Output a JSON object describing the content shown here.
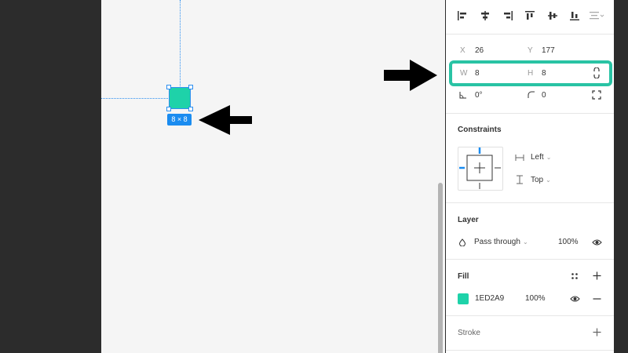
{
  "canvas": {
    "size_badge": "8 × 8",
    "shape_color": "#1ED2A9",
    "guide_color": "#2D8FF0"
  },
  "align_tools": [
    "align-left-icon",
    "align-horizontal-center-icon",
    "align-right-icon",
    "align-top-icon",
    "align-vertical-center-icon",
    "align-bottom-icon",
    "distribute-icon"
  ],
  "design": {
    "x_label": "X",
    "x_value": "26",
    "y_label": "Y",
    "y_value": "177",
    "w_label": "W",
    "w_value": "8",
    "h_label": "H",
    "h_value": "8",
    "rotation_value": "0°",
    "radius_value": "0"
  },
  "constraints": {
    "title": "Constraints",
    "horizontal": "Left",
    "vertical": "Top"
  },
  "layer": {
    "title": "Layer",
    "blend_mode": "Pass through",
    "opacity": "100%"
  },
  "fill": {
    "title": "Fill",
    "hex": "1ED2A9",
    "opacity": "100%",
    "swatch_color": "#1ED2A9"
  },
  "stroke": {
    "title": "Stroke"
  },
  "highlight_color": "#29C3A4"
}
